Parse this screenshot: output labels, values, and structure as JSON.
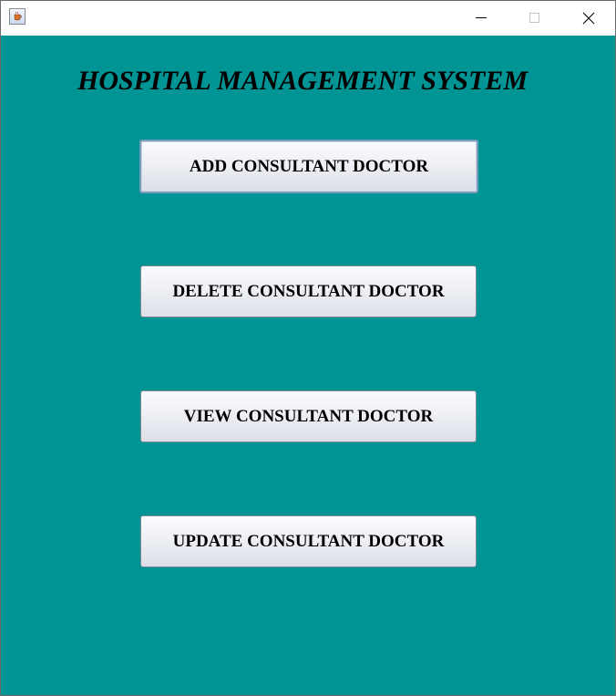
{
  "window": {
    "icon": "java-coffee-icon",
    "controls": {
      "minimize": "minimize-icon",
      "maximize": "maximize-icon",
      "close": "close-icon"
    }
  },
  "main": {
    "title": "HOSPITAL MANAGEMENT SYSTEM",
    "background_color": "#009494",
    "buttons": [
      "ADD CONSULTANT DOCTOR",
      "DELETE CONSULTANT DOCTOR",
      "VIEW CONSULTANT DOCTOR",
      "UPDATE CONSULTANT DOCTOR"
    ]
  }
}
